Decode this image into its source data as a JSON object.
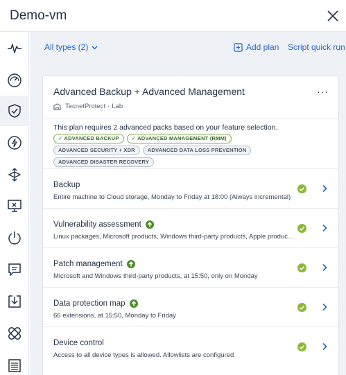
{
  "window": {
    "title": "Demo-vm"
  },
  "toolbar": {
    "types_label": "All types (2)",
    "add_plan_label": "Add plan",
    "quick_run_label": "Script quick run"
  },
  "sidebar": {
    "items": [
      {
        "icon": "activity-icon",
        "active": false
      },
      {
        "icon": "dashboard-gauge-icon",
        "active": false
      },
      {
        "icon": "shield-check-icon",
        "active": true
      },
      {
        "icon": "lightning-icon",
        "active": false
      },
      {
        "icon": "network-arrows-icon",
        "active": false
      },
      {
        "icon": "remote-desktop-icon",
        "active": false
      },
      {
        "icon": "power-icon",
        "active": false
      },
      {
        "icon": "chat-icon",
        "active": false
      },
      {
        "icon": "download-tray-icon",
        "active": false
      },
      {
        "icon": "patch-bandage-icon",
        "active": false
      },
      {
        "icon": "document-list-icon",
        "active": false
      }
    ]
  },
  "plan": {
    "title": "Advanced Backup + Advanced Management",
    "owner": "TecnetProtect",
    "owner_sep": "·",
    "owner_unit": "Lab",
    "notice": "This plan requires 2 advanced packs based on your feature selection.",
    "badges": [
      {
        "label": "ADVANCED BACKUP",
        "enabled": true
      },
      {
        "label": "ADVANCED MANAGEMENT (RMM)",
        "enabled": true
      },
      {
        "label": "ADVANCED SECURITY + XDR",
        "enabled": false
      },
      {
        "label": "ADVANCED DATA LOSS PREVENTION",
        "enabled": false
      },
      {
        "label": "ADVANCED DISASTER RECOVERY",
        "enabled": false
      }
    ],
    "modules": [
      {
        "name": "Backup",
        "description": "Entire machine to Cloud storage, Monday to Friday at 18:00 (Always incremental)",
        "upgrade": false,
        "status": "ok"
      },
      {
        "name": "Vulnerability assessment",
        "description": "Linux packages, Microsoft products, Windows third-party products, Apple products, m...",
        "upgrade": true,
        "status": "ok"
      },
      {
        "name": "Patch management",
        "description": "Microsoft and Windows third-party products, at 15:50, only on Monday",
        "upgrade": true,
        "status": "ok"
      },
      {
        "name": "Data protection map",
        "description": "66 extensions, at 15:50, Monday to Friday",
        "upgrade": true,
        "status": "ok"
      },
      {
        "name": "Device control",
        "description": "Access to all device types is allowed. Allowlists are configured",
        "upgrade": false,
        "status": "ok"
      }
    ]
  },
  "colors": {
    "accent": "#2668c5",
    "status_ok": "#8bb83a",
    "upgrade_green": "#4c8c2b",
    "text": "#243143",
    "main_bg": "#eef1f5"
  }
}
